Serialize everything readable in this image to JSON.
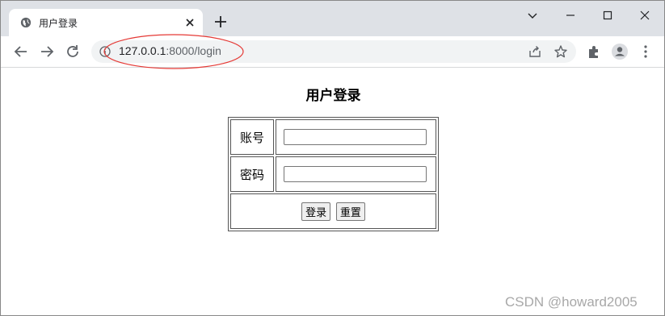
{
  "browser": {
    "tab": {
      "title": "用户登录",
      "favicon": "globe-icon",
      "close_icon": "close-icon"
    },
    "new_tab_icon": "plus-icon",
    "window_controls": [
      "chevron-down-icon",
      "minimize-icon",
      "maximize-icon",
      "close-icon"
    ],
    "nav": [
      "back-arrow-icon",
      "forward-arrow-icon",
      "reload-icon"
    ],
    "address": {
      "host": "127.0.0.1",
      "path": ":8000/login",
      "info_icon": "info-icon"
    },
    "omnibox_actions": [
      "share-icon",
      "star-icon"
    ],
    "toolbar_actions": [
      "extensions-icon",
      "profile-icon",
      "more-menu-icon"
    ],
    "annotation_color": "#e53935"
  },
  "page": {
    "title": "用户登录",
    "form": {
      "account_label": "账号",
      "account_value": "",
      "password_label": "密码",
      "password_value": "",
      "login_button": "登录",
      "reset_button": "重置"
    }
  },
  "watermark": "CSDN @howard2005"
}
